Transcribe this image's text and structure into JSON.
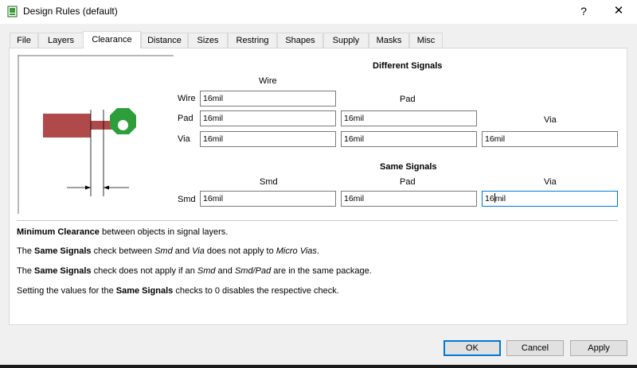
{
  "window": {
    "title": "Design Rules (default)",
    "help_label": "?",
    "close_label": "✕",
    "icon": "design-rules-icon"
  },
  "tabs": [
    {
      "label": "File"
    },
    {
      "label": "Layers"
    },
    {
      "label": "Clearance",
      "active": true
    },
    {
      "label": "Distance"
    },
    {
      "label": "Sizes"
    },
    {
      "label": "Restring"
    },
    {
      "label": "Shapes"
    },
    {
      "label": "Supply"
    },
    {
      "label": "Masks"
    },
    {
      "label": "Misc"
    }
  ],
  "different_signals": {
    "heading": "Different Signals",
    "col_wire": "Wire",
    "col_pad": "Pad",
    "col_via": "Via",
    "row_wire": "Wire",
    "row_pad": "Pad",
    "row_via": "Via",
    "wire_wire": "16mil",
    "pad_wire": "16mil",
    "pad_pad": "16mil",
    "via_wire": "16mil",
    "via_pad": "16mil",
    "via_via": "16mil"
  },
  "same_signals": {
    "heading": "Same Signals",
    "col_smd": "Smd",
    "col_pad": "Pad",
    "col_via": "Via",
    "row_smd": "Smd",
    "smd_smd": "16mil",
    "smd_pad": "16mil",
    "smd_via_before": "16",
    "smd_via_after": "mil"
  },
  "desc": {
    "line1_b": "Minimum Clearance",
    "line1_t": " between objects in signal layers.",
    "line2_a": "The ",
    "line2_b": "Same Signals",
    "line2_c": " check between ",
    "line2_i1": "Smd",
    "line2_d": " and ",
    "line2_i2": "Via",
    "line2_e": " does not apply to ",
    "line2_i3": "Micro Vias",
    "line2_f": ".",
    "line3_a": "The ",
    "line3_b": "Same Signals",
    "line3_c": " check does not apply if an ",
    "line3_i1": "Smd",
    "line3_d": " and ",
    "line3_i2": "Smd/Pad",
    "line3_e": " are in the same package.",
    "line4_a": "Setting the values for the ",
    "line4_b": "Same Signals",
    "line4_c": " checks to 0 disables the respective check."
  },
  "buttons": {
    "ok": "OK",
    "cancel": "Cancel",
    "apply": "Apply"
  },
  "colors": {
    "wire": "#b04a4a",
    "pad": "#2e9e3a",
    "focus": "#0078d7"
  }
}
